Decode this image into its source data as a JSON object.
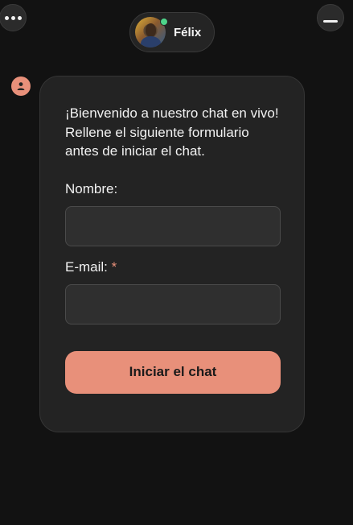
{
  "header": {
    "menu_icon": "more-dots-icon",
    "minimize_icon": "minimize-icon",
    "agent": {
      "name": "Félix",
      "status": "online",
      "status_color": "#4ed48a",
      "avatar_icon": "agent-avatar"
    }
  },
  "form": {
    "user_icon": "user-icon",
    "welcome_line1": "¡Bienvenido a nuestro chat en vivo!",
    "welcome_line2": "Rellene el siguiente formulario antes de iniciar el chat.",
    "name_label": "Nombre:",
    "name_value": "",
    "email_label": "E-mail:",
    "email_required_mark": "*",
    "email_value": "",
    "submit_label": "Iniciar el chat"
  },
  "colors": {
    "background": "#121212",
    "card": "#232323",
    "accent": "#e8907a",
    "input_bg": "#2f2f2f"
  }
}
